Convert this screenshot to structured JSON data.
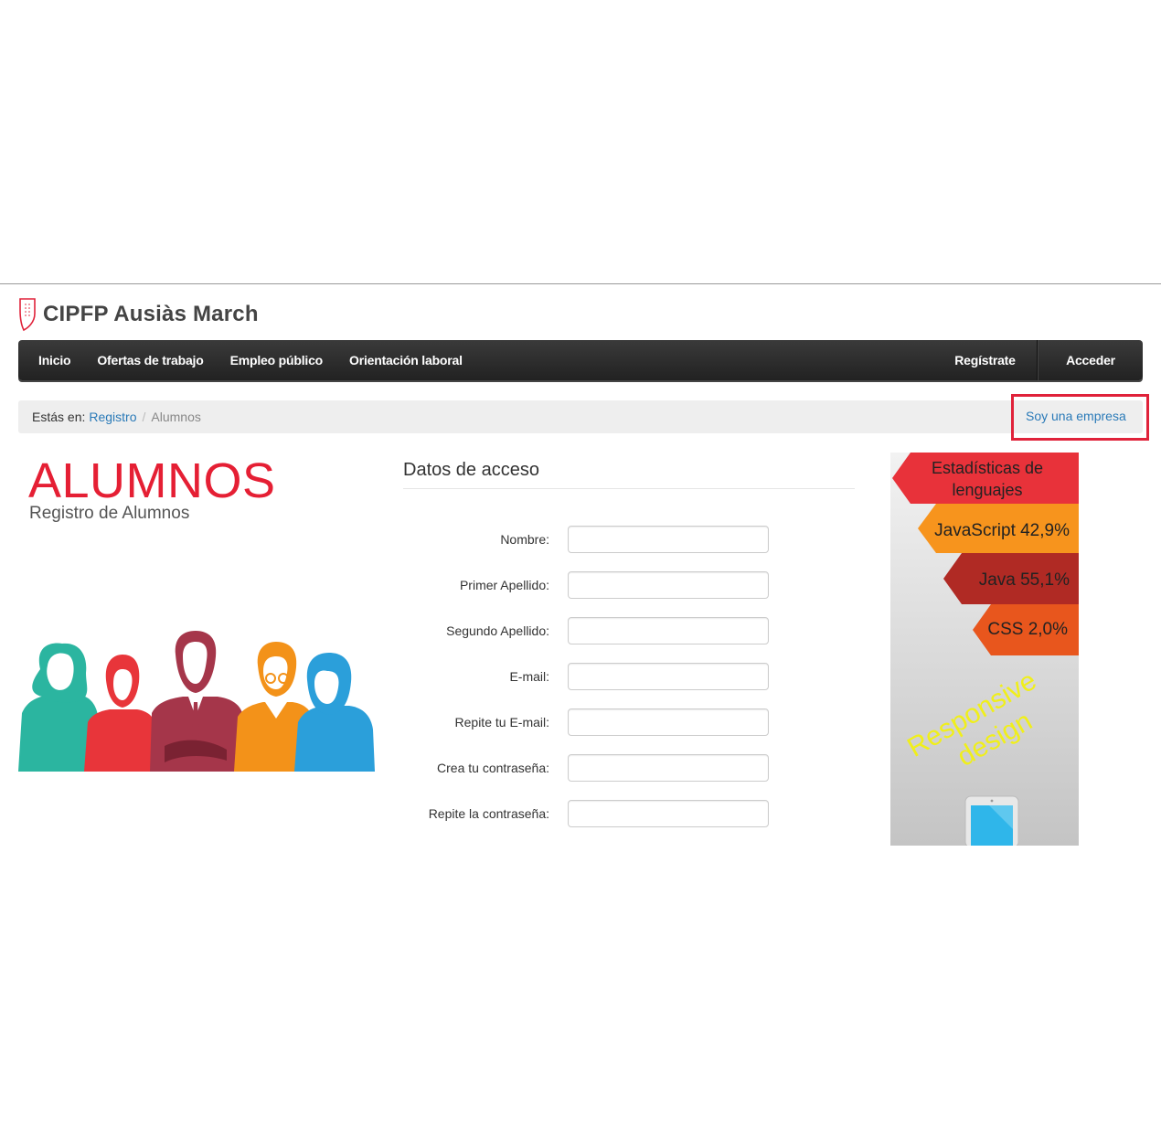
{
  "brand": {
    "name": "CIPFP Ausiàs March"
  },
  "navbar": {
    "left_items": [
      "Inicio",
      "Ofertas de trabajo",
      "Empleo público",
      "Orientación laboral"
    ],
    "register_label": "Regístrate",
    "login_label": "Acceder"
  },
  "breadcrumb": {
    "prefix": "Estás en:",
    "link": "Registro",
    "separator": "/",
    "current": "Alumnos",
    "company_link": "Soy una empresa"
  },
  "hero": {
    "title": "ALUMNOS",
    "subtitle": "Registro de Alumnos"
  },
  "form": {
    "title": "Datos de acceso",
    "fields": [
      {
        "label": "Nombre:",
        "value": ""
      },
      {
        "label": "Primer Apellido:",
        "value": ""
      },
      {
        "label": "Segundo Apellido:",
        "value": ""
      },
      {
        "label": "E-mail:",
        "value": ""
      },
      {
        "label": "Repite tu E-mail:",
        "value": ""
      },
      {
        "label": "Crea tu contraseña:",
        "value": ""
      },
      {
        "label": "Repite la contraseña:",
        "value": ""
      }
    ]
  },
  "ad": {
    "heading_line1": "Estadísticas de",
    "heading_line2": "lenguajes",
    "stats": [
      "JavaScript 42,9%",
      "Java 55,1%",
      "CSS 2,0%"
    ],
    "slogan_line1": "Responsive",
    "slogan_line2": "design"
  },
  "colors": {
    "accent_red": "#e51f34",
    "link_blue": "#2a7ab8",
    "navbar": "#2b2b2b",
    "highlight_box": "#e0223a"
  }
}
